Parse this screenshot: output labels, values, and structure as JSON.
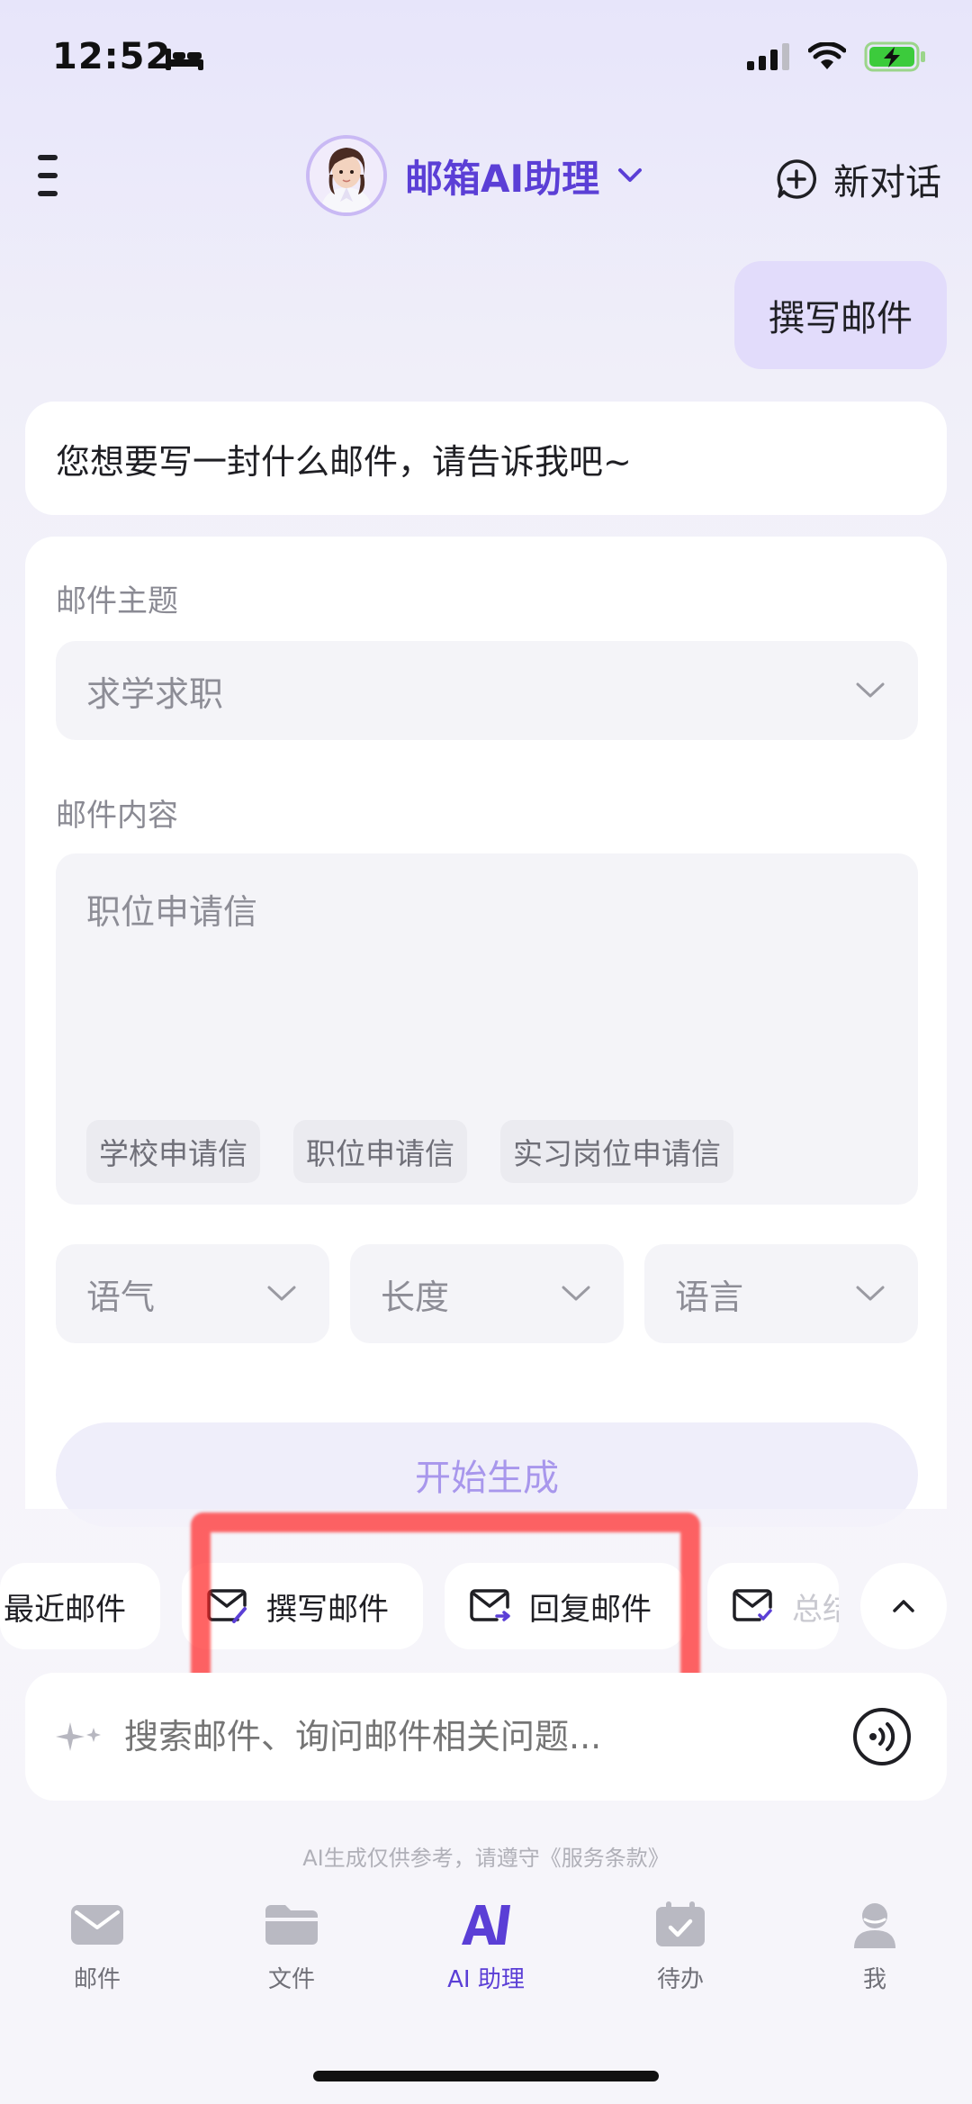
{
  "status": {
    "time": "12:52"
  },
  "header": {
    "title": "邮箱AI助理",
    "new_chat": "新对话"
  },
  "chat": {
    "user_message": "撰写邮件",
    "ai_message": "您想要写一封什么邮件，请告诉我吧~"
  },
  "form": {
    "subject_label": "邮件主题",
    "subject_value": "求学求职",
    "content_label": "邮件内容",
    "content_value": "职位申请信",
    "chips": [
      "学校申请信",
      "职位申请信",
      "实习岗位申请信"
    ],
    "tone": "语气",
    "length": "长度",
    "language": "语言",
    "generate": "开始生成"
  },
  "quick_actions": [
    "最近邮件",
    "撰写邮件",
    "回复邮件",
    "总结"
  ],
  "input": {
    "placeholder": "搜索邮件、询问邮件相关问题..."
  },
  "disclaimer": "AI生成仅供参考，请遵守《服务条款》",
  "tabs": [
    {
      "label": "邮件",
      "icon": "mail-icon"
    },
    {
      "label": "文件",
      "icon": "folder-icon"
    },
    {
      "label": "AI 助理",
      "icon": "ai-icon",
      "active": true
    },
    {
      "label": "待办",
      "icon": "calendar-check-icon"
    },
    {
      "label": "我",
      "icon": "user-icon"
    }
  ],
  "colors": {
    "accent": "#5b3fd6",
    "bubble": "#e2dcfb",
    "highlight": "#ff2828"
  }
}
